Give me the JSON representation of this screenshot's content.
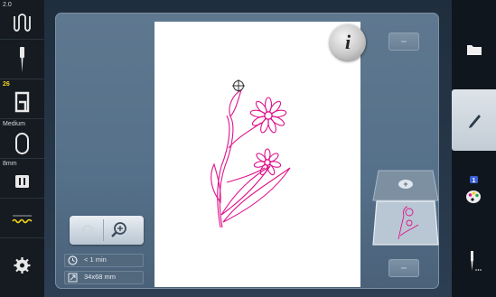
{
  "left_sidebar": {
    "items": [
      {
        "top_label": "2.0",
        "icon": "stitch-width-icon"
      },
      {
        "top_label": "",
        "icon": "needle-icon"
      },
      {
        "top_label": "26",
        "icon": "presser-foot-icon"
      },
      {
        "top_label": "Medium",
        "icon": "hoop-icon"
      },
      {
        "top_label": "8mm",
        "icon": "stitch-plate-icon"
      },
      {
        "top_label": "",
        "icon": "thread-tension-icon"
      },
      {
        "top_label": "",
        "icon": "settings-gear-icon"
      }
    ]
  },
  "info_button": {
    "label": "i"
  },
  "readouts": {
    "time": "< 1 min",
    "size": "34x68 mm"
  },
  "zoom": {
    "icon": "zoom-in-icon",
    "pan_icon": "hand-pan-icon"
  },
  "layers": {
    "badge": "+",
    "colors_badge": "1"
  },
  "right_sidebar": {
    "items": [
      {
        "icon": "folder-icon"
      },
      {
        "icon": "pencil-edit-icon"
      },
      {
        "icon": "color-palette-icon"
      },
      {
        "icon": "needle-start-icon"
      }
    ]
  },
  "colors": {
    "design_pink": "#e0148c",
    "panel_blue": "#5f7890",
    "accent_yellow": "#f2d21b"
  }
}
